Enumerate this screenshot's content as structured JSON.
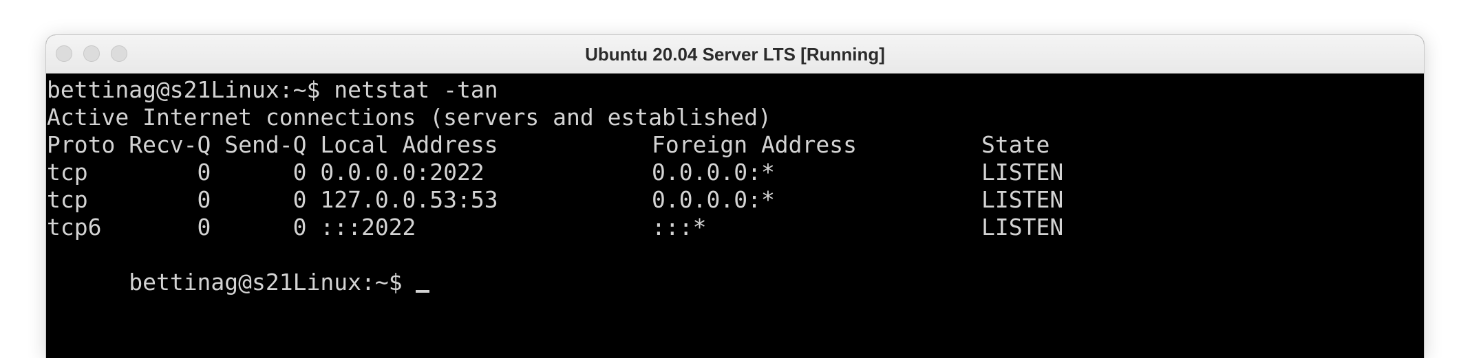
{
  "window": {
    "title": "Ubuntu 20.04 Server LTS [Running]"
  },
  "terminal": {
    "command_line": "bettinag@s21Linux:~$ netstat -tan",
    "summary": "Active Internet connections (servers and established)",
    "headers": {
      "proto_recvq_sendq_local": "Proto Recv-Q Send-Q Local Address",
      "foreign": "Foreign Address",
      "state": "State"
    },
    "rows": [
      {
        "left": "tcp        0      0 0.0.0.0:2022",
        "foreign": "0.0.0.0:*",
        "state": "LISTEN"
      },
      {
        "left": "tcp        0      0 127.0.0.53:53",
        "foreign": "0.0.0.0:*",
        "state": "LISTEN"
      },
      {
        "left": "tcp6       0      0 :::2022",
        "foreign": ":::*",
        "state": "LISTEN"
      }
    ],
    "prompt": "bettinag@s21Linux:~$ "
  },
  "colors": {
    "terminal_bg": "#000000",
    "terminal_fg": "#d3d3d3",
    "titlebar_bg": "#ececec"
  }
}
